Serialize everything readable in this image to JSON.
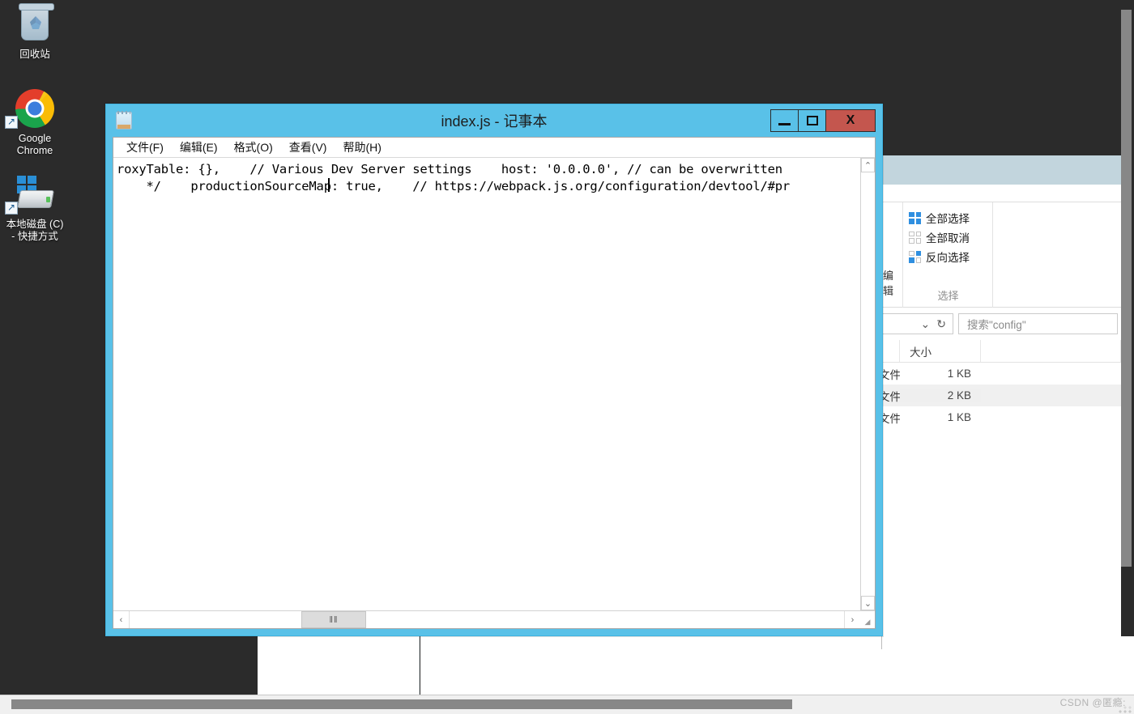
{
  "desktop": {
    "icons": [
      {
        "name": "recycle-bin",
        "label": "回收站"
      },
      {
        "name": "google-chrome",
        "label": "Google\nChrome"
      },
      {
        "name": "local-disk-c-shortcut",
        "label": "本地磁盘 (C)\n- 快捷方式"
      }
    ]
  },
  "notepad": {
    "title": "index.js - 记事本",
    "window_buttons": {
      "minimize": "—",
      "maximize": "□",
      "close": "X"
    },
    "menu": [
      {
        "name": "file",
        "label": "文件(F)"
      },
      {
        "name": "edit",
        "label": "编辑(E)"
      },
      {
        "name": "format",
        "label": "格式(O)"
      },
      {
        "name": "view",
        "label": "查看(V)"
      },
      {
        "name": "help",
        "label": "帮助(H)"
      }
    ],
    "content_lines": [
      "roxyTable: {},    // Various Dev Server settings    host: '0.0.0.0', // can be overwritten",
      "    */    productionSourceMap: true,    // https://webpack.js.org/configuration/devtool/#pr"
    ],
    "scrollbar": {
      "up_arrow": "⌃",
      "down_arrow": "⌄",
      "left_arrow": "‹",
      "right_arrow": "›",
      "thumb_grip": "‖‖"
    }
  },
  "explorer": {
    "ribbon": {
      "edit_group_label": "编辑",
      "select_group_label": "选择",
      "items": [
        {
          "name": "select-all",
          "label": "全部选择",
          "icon": "all"
        },
        {
          "name": "select-none",
          "label": "全部取消",
          "icon": "none"
        },
        {
          "name": "invert-selection",
          "label": "反向选择",
          "icon": "inv"
        }
      ]
    },
    "address_bar": {
      "dropdown_icon": "⌄",
      "refresh_icon": "↻"
    },
    "search": {
      "placeholder": "搜索\"config\""
    },
    "columns": [
      {
        "name": "type",
        "label": ""
      },
      {
        "name": "size",
        "label": "大小"
      }
    ],
    "rows": [
      {
        "type": "文件",
        "size": "1 KB",
        "selected": false
      },
      {
        "type": "文件",
        "size": "2 KB",
        "selected": true
      },
      {
        "type": "文件",
        "size": "1 KB",
        "selected": false
      }
    ]
  },
  "watermark": {
    "text": "CSDN @匿瘾:"
  }
}
